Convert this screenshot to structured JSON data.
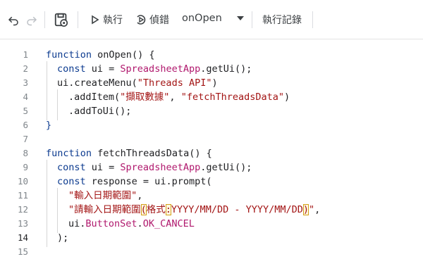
{
  "toolbar": {
    "undo_icon": "undo-icon",
    "redo_icon": "redo-icon",
    "save_icon": "save-icon",
    "run_label": "執行",
    "debug_label": "偵錯",
    "function_select": "onOpen",
    "log_label": "執行記錄"
  },
  "lines": [
    {
      "n": "1"
    },
    {
      "n": "2"
    },
    {
      "n": "3"
    },
    {
      "n": "4"
    },
    {
      "n": "5"
    },
    {
      "n": "6"
    },
    {
      "n": "7"
    },
    {
      "n": "8"
    },
    {
      "n": "9"
    },
    {
      "n": "10"
    },
    {
      "n": "11"
    },
    {
      "n": "12"
    },
    {
      "n": "13"
    },
    {
      "n": "14"
    },
    {
      "n": "15"
    }
  ],
  "code": {
    "l1": {
      "kw": "function ",
      "name": "onOpen",
      "rest": "() {"
    },
    "l2": {
      "kw": "const ",
      "var": "ui = ",
      "cls": "SpreadsheetApp",
      "rest": ".getUi();"
    },
    "l3": {
      "pre": "ui.createMenu(",
      "str": "\"Threads API\"",
      "post": ")"
    },
    "l4": {
      "pre": ".addItem(",
      "s1": "\"擷取數據\"",
      "mid": ", ",
      "s2": "\"fetchThreadsData\"",
      "post": ")"
    },
    "l5": {
      "text": ".addToUi();"
    },
    "l6": {
      "text": "}"
    },
    "l8": {
      "kw": "function ",
      "name": "fetchThreadsData",
      "rest": "() {"
    },
    "l9": {
      "kw": "const ",
      "var": "ui = ",
      "cls": "SpreadsheetApp",
      "rest": ".getUi();"
    },
    "l10": {
      "kw": "const ",
      "rest": "response = ui.prompt("
    },
    "l11": {
      "str": "\"輸入日期範圍\"",
      "post": ","
    },
    "l12": {
      "q": "\"",
      "s1": "請輸入日期範圍",
      "p1": "(",
      "s2": "格式",
      "c": ":",
      "s3": "YYYY/MM/DD - YYYY/MM/DD",
      "p2": ")",
      "q2": "\"",
      "post": ","
    },
    "l13": {
      "pre": "ui.",
      "cls": "ButtonSet",
      "dot": ".",
      "cls2": "OK_CANCEL"
    },
    "l14": {
      "text": ");"
    }
  }
}
